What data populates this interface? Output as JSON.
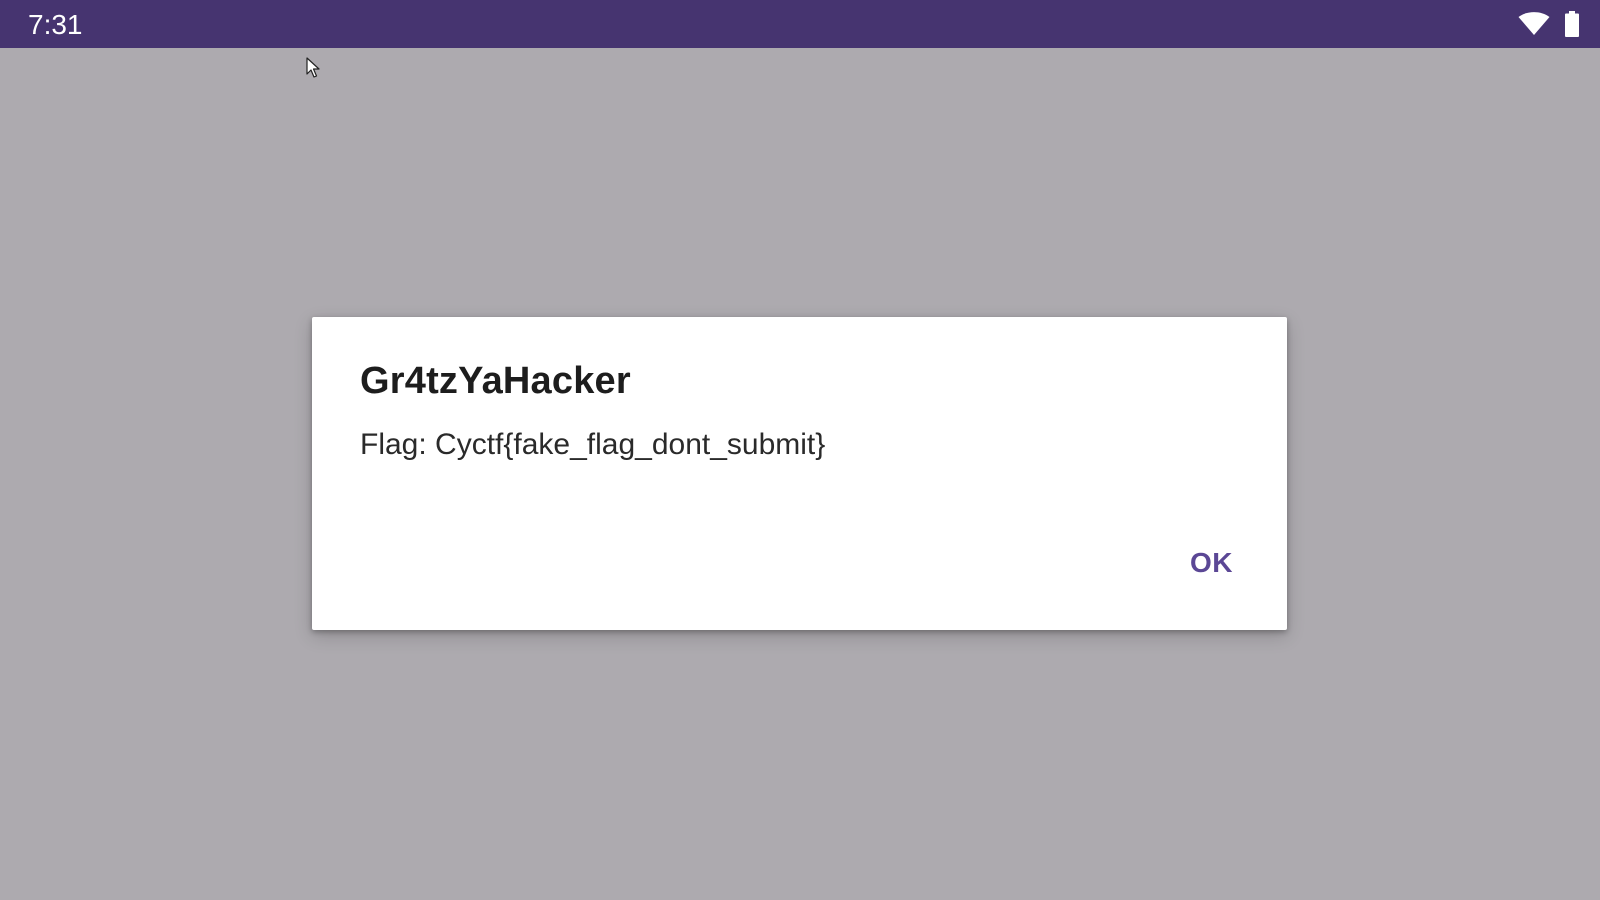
{
  "status_bar": {
    "time": "7:31",
    "icons": [
      "wifi-icon",
      "battery-icon"
    ],
    "background": "#463470"
  },
  "dialog": {
    "title": "Gr4tzYaHacker",
    "message": "Flag: Cyctf{fake_flag_dont_submit}",
    "ok_label": "OK",
    "accent_color": "#5b4795"
  },
  "scrim_color": "#adaaaf"
}
